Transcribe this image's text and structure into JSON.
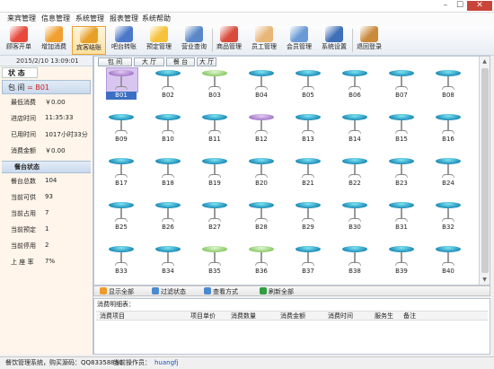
{
  "menu": [
    "来宾管理",
    "信息管理",
    "系统管理",
    "报表管理",
    "系统帮助"
  ],
  "toolbar": [
    {
      "label": "顾客开单",
      "color": "#e74a3c",
      "icon": "order-icon"
    },
    {
      "label": "增加消费",
      "color": "#f0a030",
      "icon": "add-consumption-icon"
    },
    {
      "label": "宾客结账",
      "color": "#e8a028",
      "icon": "checkout-icon"
    },
    {
      "label": "吧台转账",
      "color": "#4b78c8",
      "icon": "transfer-icon"
    },
    {
      "label": "预定管理",
      "color": "#f5c23a",
      "icon": "reservation-icon"
    },
    {
      "label": "营业查询",
      "color": "#5a87c8",
      "icon": "business-query-icon"
    },
    {
      "label": "商品管理",
      "color": "#d94b3a",
      "icon": "goods-icon"
    },
    {
      "label": "员工管理",
      "color": "#e9b679",
      "icon": "staff-icon"
    },
    {
      "label": "会员管理",
      "color": "#6a9ad6",
      "icon": "member-icon"
    },
    {
      "label": "系统设置",
      "color": "#3f6fb8",
      "icon": "settings-icon"
    },
    {
      "label": "退回登录",
      "color": "#c98a3a",
      "icon": "logout-icon"
    }
  ],
  "left": {
    "datetime": "2015/2/10 13:09:01",
    "state_title": "状 态",
    "room_prefix": "包 间",
    "room_no": "= B01",
    "info": [
      {
        "k": "最低消费",
        "v": "￥0.00"
      },
      {
        "k": "进店时间",
        "v": "11:35:33"
      },
      {
        "k": "已用时间",
        "v": "1017小时33分"
      },
      {
        "k": "消费金额",
        "v": "￥0.00"
      }
    ],
    "table_state_title": "餐台状态",
    "stats": [
      {
        "k": "餐台总数",
        "v": "104"
      },
      {
        "k": "当前可供",
        "v": "93"
      },
      {
        "k": "当前占用",
        "v": "7"
      },
      {
        "k": "当前预定",
        "v": "1"
      },
      {
        "k": "当前停用",
        "v": "2"
      },
      {
        "k": "上 座 率",
        "v": "7%"
      }
    ]
  },
  "filters": [
    "包 间",
    "大 厅",
    "餐 台",
    "大 厅"
  ],
  "tables": [
    {
      "name": "B01",
      "state": "occ",
      "selected": true
    },
    {
      "name": "B02",
      "state": "free"
    },
    {
      "name": "B03",
      "state": "res"
    },
    {
      "name": "B04",
      "state": "free"
    },
    {
      "name": "B05",
      "state": "free"
    },
    {
      "name": "B06",
      "state": "free"
    },
    {
      "name": "B07",
      "state": "free"
    },
    {
      "name": "B08",
      "state": "free"
    },
    {
      "name": "B09",
      "state": "free"
    },
    {
      "name": "B10",
      "state": "free"
    },
    {
      "name": "B11",
      "state": "free"
    },
    {
      "name": "B12",
      "state": "occ"
    },
    {
      "name": "B13",
      "state": "free"
    },
    {
      "name": "B14",
      "state": "free"
    },
    {
      "name": "B15",
      "state": "free"
    },
    {
      "name": "B16",
      "state": "free"
    },
    {
      "name": "B17",
      "state": "free"
    },
    {
      "name": "B18",
      "state": "free"
    },
    {
      "name": "B19",
      "state": "free"
    },
    {
      "name": "B20",
      "state": "free"
    },
    {
      "name": "B21",
      "state": "free"
    },
    {
      "name": "B22",
      "state": "free"
    },
    {
      "name": "B23",
      "state": "free"
    },
    {
      "name": "B24",
      "state": "free"
    },
    {
      "name": "B25",
      "state": "free"
    },
    {
      "name": "B26",
      "state": "free"
    },
    {
      "name": "B27",
      "state": "free"
    },
    {
      "name": "B28",
      "state": "free"
    },
    {
      "name": "B29",
      "state": "free"
    },
    {
      "name": "B30",
      "state": "free"
    },
    {
      "name": "B31",
      "state": "free"
    },
    {
      "name": "B32",
      "state": "free"
    },
    {
      "name": "B33",
      "state": "free"
    },
    {
      "name": "B34",
      "state": "free"
    },
    {
      "name": "B35",
      "state": "res"
    },
    {
      "name": "B36",
      "state": "res"
    },
    {
      "name": "B37",
      "state": "free"
    },
    {
      "name": "B38",
      "state": "free"
    },
    {
      "name": "B39",
      "state": "free"
    },
    {
      "name": "B40",
      "state": "free"
    }
  ],
  "bottombar": [
    "显示全部",
    "过滤状态",
    "查看方式",
    "刷新全部"
  ],
  "consumption": {
    "caption": "消费明细表：",
    "columns": [
      "消费项目",
      "项目单价",
      "消费数量",
      "消费金额",
      "消费时间",
      "服务生",
      "备注"
    ]
  },
  "status": {
    "system": "餐饮管理系统，购买源码：QQ83358880",
    "operator_label": "当前操作员：",
    "operator": "huangfj"
  },
  "window": {
    "minimize": "–",
    "maximize": "☐",
    "close": "✕"
  }
}
